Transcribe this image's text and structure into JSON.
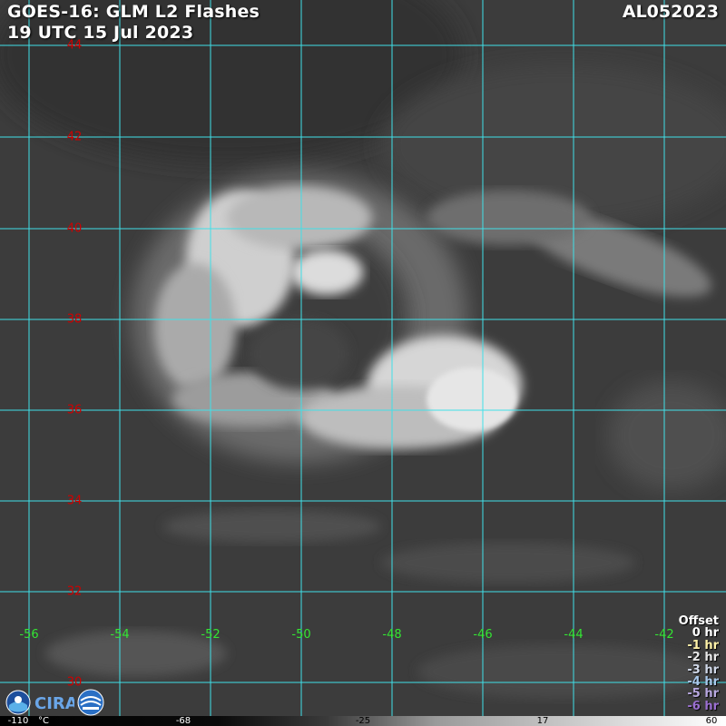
{
  "title": {
    "line1": "GOES-16: GLM L2 Flashes",
    "line2": "19 UTC 15 Jul 2023",
    "storm_id": "AL052023"
  },
  "latitude_labels": [
    "44",
    "42",
    "40",
    "38",
    "36",
    "34",
    "32",
    "30"
  ],
  "longitude_labels": [
    "-56",
    "-54",
    "-52",
    "-50",
    "-48",
    "-46",
    "-44",
    "-42"
  ],
  "offset_legend": {
    "heading": "Offset",
    "items": [
      {
        "label": "0 hr",
        "color": "#ffffff"
      },
      {
        "label": "-1 hr",
        "color": "#fff2a8"
      },
      {
        "label": "-2 hr",
        "color": "#e8e8e8"
      },
      {
        "label": "-3 hr",
        "color": "#d0d8e8"
      },
      {
        "label": "-4 hr",
        "color": "#a9c9ec"
      },
      {
        "label": "-5 hr",
        "color": "#b8a8e0"
      },
      {
        "label": "-6 hr",
        "color": "#9a6fd0"
      }
    ]
  },
  "colorbar": {
    "ticks": [
      "-110",
      "°C",
      "-68",
      "-25",
      "17",
      "60"
    ]
  },
  "grid_color": "#40e0e8",
  "logos": [
    "noaa-logo-icon",
    "cira-logo-icon",
    "rammb-logo-icon"
  ]
}
